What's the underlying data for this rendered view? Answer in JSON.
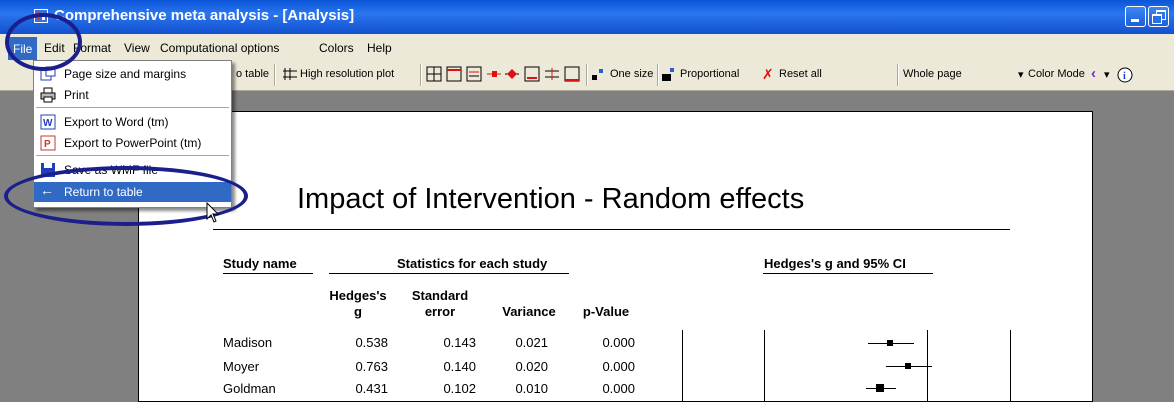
{
  "window": {
    "title": "Comprehensive meta analysis - [Analysis]"
  },
  "menu": {
    "items": [
      "File",
      "Edit",
      "Format",
      "View",
      "Computational options",
      "Colors",
      "Help"
    ]
  },
  "toolbar": {
    "table_label": "o table",
    "high_res_label": "High resolution plot",
    "one_size_label": "One size",
    "proportional_label": "Proportional",
    "reset_label": "Reset all",
    "whole_page_label": "Whole page",
    "color_mode_label": "Color Mode"
  },
  "file_menu": {
    "items": [
      {
        "label": "Page size and margins",
        "icon": "page-size-icon"
      },
      {
        "label": "Print",
        "icon": "printer-icon"
      },
      {
        "label": "Export to Word (tm)",
        "icon": "word-icon"
      },
      {
        "label": "Export to PowerPoint (tm)",
        "icon": "powerpoint-icon"
      },
      {
        "label": "Save as WMF file",
        "icon": "save-icon"
      },
      {
        "label": "Return to table",
        "icon": "arrow-left-icon",
        "selected": true
      }
    ]
  },
  "report": {
    "title": "Impact of Intervention - Random effects",
    "study_header": "Study name",
    "stats_header": "Statistics for each study",
    "ci_header": "Hedges's g and 95% CI",
    "columns": [
      "Hedges's g",
      "Standard error",
      "Variance",
      "p-Value"
    ],
    "rows": [
      {
        "study": "Madison",
        "g": "0.538",
        "se": "0.143",
        "var": "0.021",
        "p": "0.000"
      },
      {
        "study": "Moyer",
        "g": "0.763",
        "se": "0.140",
        "var": "0.020",
        "p": "0.000"
      },
      {
        "study": "Goldman",
        "g": "0.431",
        "se": "0.102",
        "var": "0.010",
        "p": "0.000"
      }
    ]
  },
  "colors": {
    "highlight": "#316ac5",
    "annotation_ring": "#1a1f8c",
    "titlebar": "#0b55d8"
  }
}
